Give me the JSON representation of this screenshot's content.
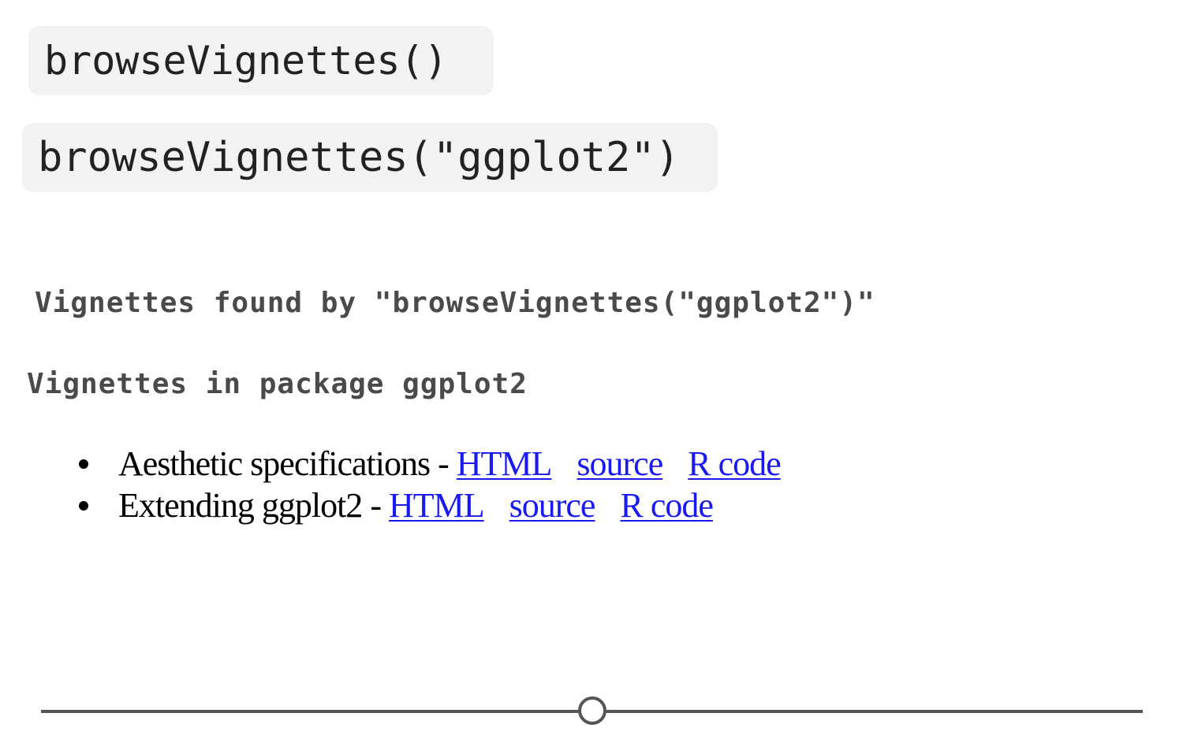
{
  "code": {
    "call_all": "browseVignettes()",
    "call_pkg": "browseVignettes(\"ggplot2\")"
  },
  "output": {
    "title": "Vignettes found by \"browseVignettes(\"ggplot2\")\"",
    "package_heading": "Vignettes in package ggplot2",
    "items": [
      {
        "name": "Aesthetic specifications",
        "separator": "-",
        "links": [
          "HTML",
          "source",
          "R code"
        ]
      },
      {
        "name": "Extending ggplot2",
        "separator": "-",
        "links": [
          "HTML",
          "source",
          "R code"
        ]
      }
    ]
  },
  "slider": {
    "position": 0.5
  },
  "colors": {
    "link": "#1a1aee",
    "chip_bg": "#f2f2f2",
    "heading": "#4a4a4a"
  }
}
